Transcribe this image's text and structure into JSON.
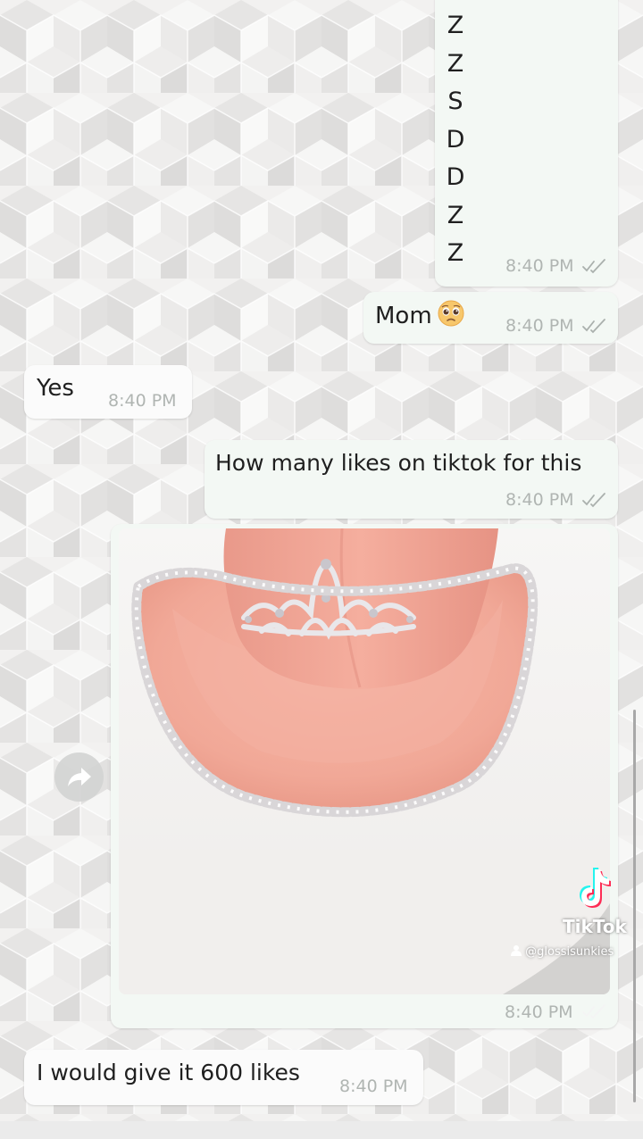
{
  "colors": {
    "outgoing_bubble": "#f3f8f4",
    "incoming_bubble": "#fbfbfb",
    "timestamp": "#b0b5b2",
    "read_ticks": "#aab0ad",
    "text": "#1f1f1f"
  },
  "messages": {
    "letters": {
      "direction": "outgoing",
      "lines": [
        "Z",
        "Z",
        "S",
        "D",
        "D",
        "Z",
        "Z"
      ],
      "time": "8:40 PM",
      "status_icon": "double-check-icon"
    },
    "mom": {
      "direction": "outgoing",
      "text": "Mom",
      "emoji": "pleading-face-emoji",
      "time": "8:40 PM",
      "status_icon": "double-check-icon"
    },
    "yes": {
      "direction": "incoming",
      "text": "Yes",
      "time": "8:40 PM"
    },
    "question": {
      "direction": "outgoing",
      "text": "How many likes on tiktok for this",
      "time": "8:40 PM",
      "status_icon": "double-check-icon"
    },
    "photo": {
      "direction": "outgoing",
      "image": "pink-cowgirl-hat-with-tiara-photo",
      "time": "8:40 PM",
      "status_icon": "double-check-icon",
      "forward_icon": "forward-arrow-icon"
    },
    "answer": {
      "direction": "incoming",
      "text": "I would give it 600 likes",
      "time": "8:40 PM"
    }
  },
  "watermark": {
    "icon": "tiktok-logo-icon",
    "name": "TikTok",
    "user_icon": "person-icon",
    "username": "@glossisunkies"
  }
}
